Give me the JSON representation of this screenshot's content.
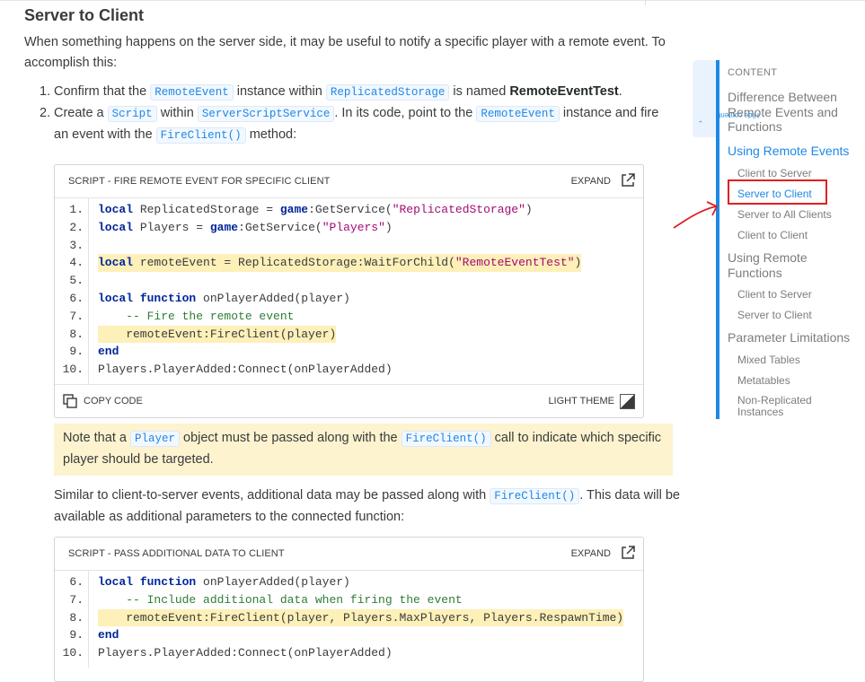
{
  "article": {
    "heading": "Server to Client",
    "intro": "When something happens on the server side, it may be useful to notify a specific player with a remote event. To accomplish this:",
    "steps": [
      {
        "num": "1.",
        "t1": "Confirm that the ",
        "c1": "RemoteEvent",
        "t2": " instance within ",
        "c2": "ReplicatedStorage",
        "t3": " is named ",
        "b1": "RemoteEventTest",
        "t4": "."
      },
      {
        "num": "2.",
        "t1": "Create a ",
        "c1": "Script",
        "t2": " within ",
        "c2": "ServerScriptService",
        "t3": ". In its code, point to the ",
        "c3": "RemoteEvent",
        "t4": " instance and fire an event with the ",
        "c4": "FireClient()",
        "t5": " method:"
      }
    ],
    "code1": {
      "title": "SCRIPT - FIRE REMOTE EVENT FOR SPECIFIC CLIENT",
      "expand": "EXPAND",
      "copy": "COPY CODE",
      "theme": "LIGHT THEME",
      "lines": [
        {
          "n": "1.",
          "a": "local",
          "b": " ReplicatedStorage = ",
          "c": "game",
          "d": ":GetService(",
          "e": "\"ReplicatedStorage\"",
          "f": ")"
        },
        {
          "n": "2.",
          "a": "local",
          "b": " Players = ",
          "c": "game",
          "d": ":GetService(",
          "e": "\"Players\"",
          "f": ")"
        },
        {
          "n": "3."
        },
        {
          "n": "4.",
          "a": "local",
          "b": " remoteEvent = ReplicatedStorage:WaitForChild(",
          "e": "\"RemoteEventTest\"",
          "f": ")"
        },
        {
          "n": "5."
        },
        {
          "n": "6.",
          "a": "local",
          "g": " function",
          "b": " onPlayerAdded(player)"
        },
        {
          "n": "7.",
          "h": "    -- Fire the remote event"
        },
        {
          "n": "8.",
          "b": "    remoteEvent:FireClient(player)"
        },
        {
          "n": "9.",
          "a": "end"
        },
        {
          "n": "10.",
          "b": "Players.PlayerAdded:Connect(onPlayerAdded)"
        }
      ]
    },
    "note": {
      "t1": "Note that a ",
      "c1": "Player",
      "t2": " object must be passed along with the ",
      "c2": "FireClient()",
      "t3": " call to indicate which specific player should be targeted."
    },
    "para2": {
      "t1": "Similar to client-to-server events, additional data may be passed along with ",
      "c1": "FireClient()",
      "t2": ". This data will be available as additional parameters to the connected function:"
    },
    "code2": {
      "title": "SCRIPT - PASS ADDITIONAL DATA TO CLIENT",
      "expand": "EXPAND",
      "lines": [
        {
          "n": "6.",
          "a": "local",
          "g": " function",
          "b": " onPlayerAdded(player)"
        },
        {
          "n": "7.",
          "h": "    -- Include additional data when firing the event"
        },
        {
          "n": "8.",
          "b": "    remoteEvent:FireClient(player, Players.MaxPlayers, Players.RespawnTime)"
        },
        {
          "n": "9.",
          "a": "end"
        },
        {
          "n": "10.",
          "b": "Players.PlayerAdded:Connect(onPlayerAdded)"
        }
      ]
    }
  },
  "toc": {
    "hide_label": "Hide content",
    "header": "CONTENT",
    "items": [
      {
        "label": "Difference Between Remote Events and Functions"
      },
      {
        "label": "Using Remote Events"
      },
      {
        "label": "Client to Server"
      },
      {
        "label": "Server to Client"
      },
      {
        "label": "Server to All Clients"
      },
      {
        "label": "Client to Client"
      },
      {
        "label": "Using Remote Functions"
      },
      {
        "label": "Client to Server"
      },
      {
        "label": "Server to Client"
      },
      {
        "label": "Parameter Limitations"
      },
      {
        "label": "Mixed Tables"
      },
      {
        "label": "Metatables"
      },
      {
        "label": "Non-Replicated Instances"
      }
    ],
    "active_index": 3
  },
  "colors": {
    "accent": "#1e88e5",
    "highlight": "#fdf0b8",
    "annotation": "#e02020"
  }
}
